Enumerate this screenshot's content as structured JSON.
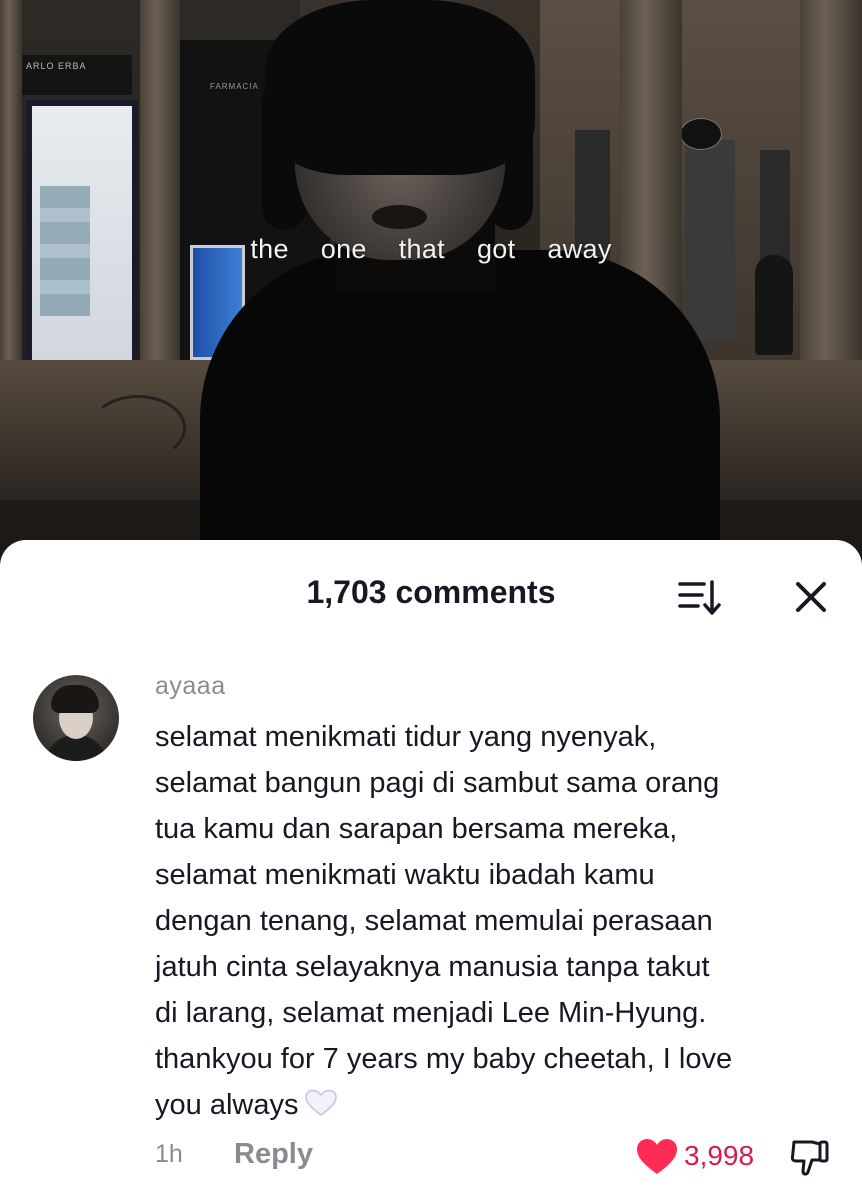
{
  "video": {
    "caption_words": [
      "the",
      "one",
      "that",
      "got",
      "away"
    ],
    "shop_sign": "ARLO ERBA",
    "pharmacy_sign": "FARMACIA"
  },
  "comments_panel": {
    "count_label": "1,703 comments",
    "sort_icon": "sort-icon",
    "close_icon": "close-icon"
  },
  "comment": {
    "username": "ayaaa",
    "text": "selamat menikmati tidur yang nyenyak,\nselamat bangun pagi di sambut sama orang\ntua kamu dan sarapan bersama mereka,\nselamat menikmati waktu ibadah kamu\ndengan tenang, selamat memulai perasaan\njatuh cinta selayaknya manusia tanpa takut\ndi larang, selamat menjadi Lee Min-Hyung.\nthankyou for 7 years my baby cheetah, I love\nyou always",
    "emoji": "white-heart",
    "time": "1h",
    "reply_label": "Reply",
    "like_count": "3,998",
    "like_color": "#fe2c55",
    "liked": true
  }
}
